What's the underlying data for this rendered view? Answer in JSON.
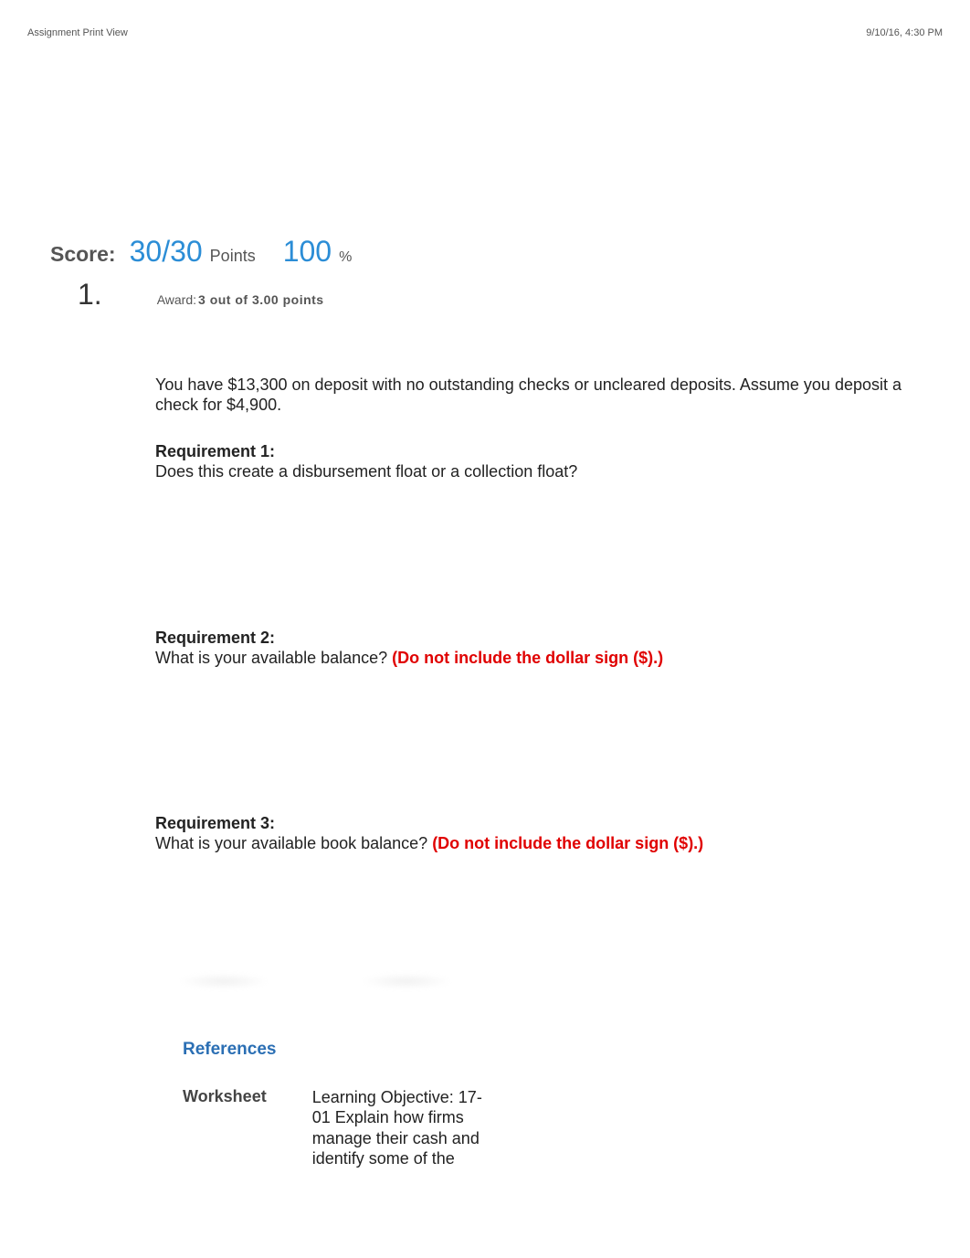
{
  "header": {
    "left": "Assignment Print View",
    "right": "9/10/16, 4:30 PM"
  },
  "score": {
    "label": "Score:",
    "value": "30/30",
    "points_label": "Points",
    "percent": "100",
    "percent_sign": "%"
  },
  "question": {
    "number": "1.",
    "award_label": "Award:",
    "award_value": "3 out of 3.00 points"
  },
  "body": {
    "intro": "You have $13,300 on deposit with no outstanding checks or uncleared deposits. Assume you deposit a check for $4,900.",
    "req1_label": "Requirement 1:",
    "req1_text": "Does this create a disbursement float or a collection float?",
    "req2_label": "Requirement 2:",
    "req2_text": "What is your available balance? ",
    "req2_note": "(Do not include the dollar sign ($).)",
    "req3_label": "Requirement 3:",
    "req3_text": "What is your available book balance? ",
    "req3_note": "(Do not include the dollar sign ($).)"
  },
  "references": {
    "heading": "References",
    "worksheet_label": "Worksheet",
    "learning_objective": "Learning Objective: 17-01 Explain how firms manage their cash and identify some of the"
  }
}
